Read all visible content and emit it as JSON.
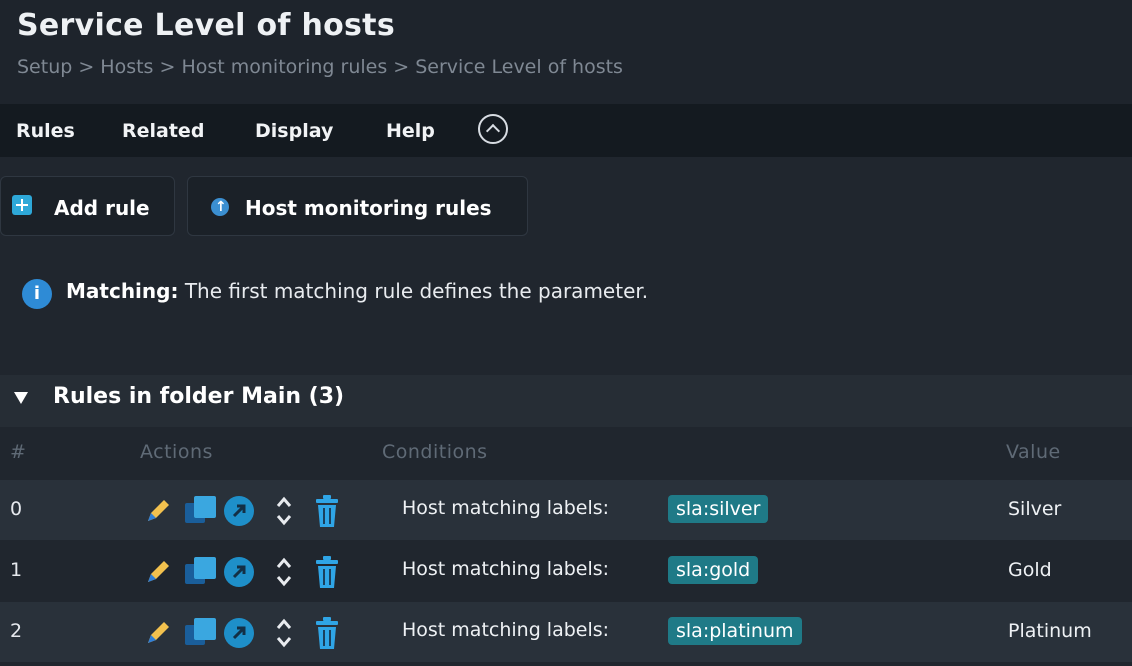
{
  "page": {
    "title": "Service Level of hosts",
    "breadcrumb": "Setup > Hosts > Host monitoring rules > Service Level of hosts"
  },
  "menu": {
    "items": [
      {
        "label": "Rules"
      },
      {
        "label": "Related"
      },
      {
        "label": "Display"
      },
      {
        "label": "Help"
      }
    ],
    "toggle_icon": "chevron-up-circle-icon"
  },
  "buttons": {
    "add_rule": "Add rule",
    "host_monitoring_rules": "Host monitoring rules"
  },
  "info": {
    "label": "Matching:",
    "text": " The first matching rule defines the parameter."
  },
  "folder": {
    "title": "Rules in folder Main (3)"
  },
  "table": {
    "headers": [
      "#",
      "Actions",
      "Conditions",
      "Value"
    ],
    "rows": [
      {
        "index": "0",
        "condition": "Host matching labels:",
        "label": "sla:silver",
        "value": "Silver"
      },
      {
        "index": "1",
        "condition": "Host matching labels:",
        "label": "sla:gold",
        "value": "Gold"
      },
      {
        "index": "2",
        "condition": "Host matching labels:",
        "label": "sla:platinum",
        "value": "Platinum"
      }
    ]
  },
  "colors": {
    "background": "#20262e",
    "accent": "#2ea8d8",
    "tag": "#1f7a87",
    "edit": "#f2c14e",
    "clone": "#3aa7e0"
  }
}
